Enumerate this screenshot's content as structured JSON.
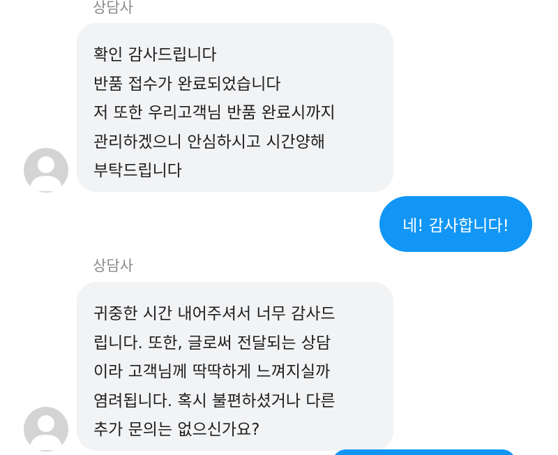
{
  "colors": {
    "incoming_bubble": "#f2f3f5",
    "outgoing_bubble": "#1196f5",
    "sender_name": "#8a8a8a",
    "avatar_placeholder": "#d4d4d4"
  },
  "messages": [
    {
      "sender": "상담사",
      "direction": "incoming",
      "avatar_icon": "default-user-avatar-icon",
      "lines": [
        "확인 감사드립니다",
        "반품 접수가 완료되었습니다",
        "저 또한 우리고객님 반품 완료시까지",
        "관리하겠으니 안심하시고 시간양해",
        "부탁드립니다"
      ]
    },
    {
      "direction": "outgoing",
      "lines": [
        "네! 감사합니다!"
      ]
    },
    {
      "sender": "상담사",
      "direction": "incoming",
      "avatar_icon": "default-user-avatar-icon",
      "lines": [
        "귀중한 시간 내어주셔서 너무 감사드",
        "립니다. 또한, 글로써 전달되는 상담",
        "이라 고객님께 딱딱하게 느껴지실까",
        "염려됩니다. 혹시 불편하셨거나 다른",
        "추가 문의는 없으신가요?"
      ]
    }
  ]
}
